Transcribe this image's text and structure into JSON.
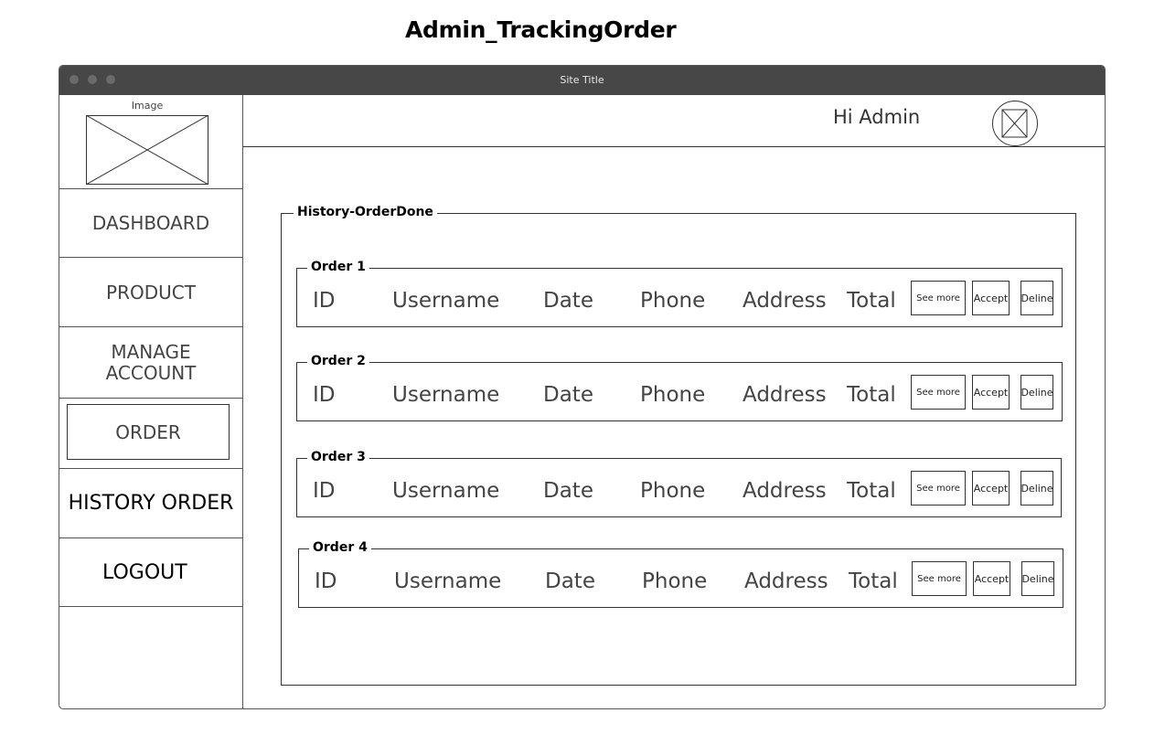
{
  "page": {
    "heading": "Admin_TrackingOrder"
  },
  "window": {
    "title": "Site Title"
  },
  "sidebar": {
    "logo_caption": "Image",
    "items": [
      {
        "label": "DASHBOARD"
      },
      {
        "label": "PRODUCT"
      },
      {
        "label": "MANAGE ACCOUNT"
      },
      {
        "label": "ORDER"
      },
      {
        "label": "HISTORY ORDER"
      },
      {
        "label": "LOGOUT"
      }
    ]
  },
  "header": {
    "greeting": "Hi Admin"
  },
  "history": {
    "title": "History-OrderDone",
    "orders": [
      {
        "title": "Order 1",
        "id": "ID",
        "username": "Username",
        "date": "Date",
        "phone": "Phone",
        "address": "Address",
        "total": "Total",
        "see_more": "See more",
        "accept": "Accept",
        "decline": "Deline"
      },
      {
        "title": "Order 2",
        "id": "ID",
        "username": "Username",
        "date": "Date",
        "phone": "Phone",
        "address": "Address",
        "total": "Total",
        "see_more": "See more",
        "accept": "Accept",
        "decline": "Deline"
      },
      {
        "title": "Order 3",
        "id": "ID",
        "username": "Username",
        "date": "Date",
        "phone": "Phone",
        "address": "Address",
        "total": "Total",
        "see_more": "See more",
        "accept": "Accept",
        "decline": "Deline"
      },
      {
        "title": "Order 4",
        "id": "ID",
        "username": "Username",
        "date": "Date",
        "phone": "Phone",
        "address": "Address",
        "total": "Total",
        "see_more": "See more",
        "accept": "Accept",
        "decline": "Deline"
      }
    ]
  },
  "icons": {
    "logo": "image-placeholder-icon",
    "avatar": "avatar-placeholder-icon"
  }
}
